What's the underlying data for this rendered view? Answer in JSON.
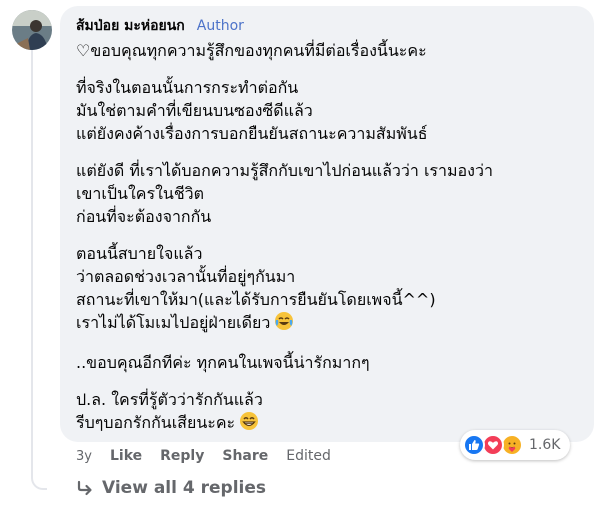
{
  "comment": {
    "author": "ส้มป่อย มะห่อยนก",
    "badge": "Author",
    "paragraphs": [
      [
        "♡ขอบคุณทุกความรู้สึกของทุกคนที่มีต่อเรื่องนี้นะคะ"
      ],
      [
        "ที่จริงในตอนนั้นการกระทำต่อกัน",
        "มันใช่ตามคำที่เขียนบนซองซีดีแล้ว",
        "แต่ยังคงค้างเรื่องการบอกยืนยันสถานะความสัมพันธ์"
      ],
      [
        "แต่ยังดี ที่เราได้บอกความรู้สึกกับเขาไปก่อนแล้วว่า เรามองว่า",
        "เขาเป็นใครในชีวิต",
        "ก่อนที่จะต้องจากกัน"
      ],
      [
        "ตอนนี้สบายใจแล้ว",
        "ว่าตลอดช่วงเวลานั้นที่อยู่ๆกันมา",
        "สถานะที่เขาให้มา(และได้รับการยืนยันโดยเพจนี้^^)",
        "เราไม่ได้โมเมไปอยู่ฝ่ายเดียว"
      ],
      [
        "..ขอบคุณอีกทีค่ะ ทุกคนในเพจนี้น่ารักมากๆ"
      ],
      [
        "ป.ล. ใครที่รู้ตัวว่ารักกันแล้ว",
        "รีบๆบอกรักกันเสียนะคะ"
      ]
    ],
    "emoji_laugh_cry": "laugh-cry-emoji",
    "emoji_grin": "grin-emoji"
  },
  "reactions": {
    "icons": [
      "like-icon",
      "love-icon",
      "care-icon"
    ],
    "count": "1.6K",
    "colors": {
      "like": "#1877f2",
      "love": "#f33e58",
      "care": "#f7b125"
    }
  },
  "actions": {
    "time": "3y",
    "like": "Like",
    "reply": "Reply",
    "share": "Share",
    "edited": "Edited"
  },
  "replies": {
    "label": "View all 4 replies"
  },
  "colors": {
    "bubble": "#f0f2f5",
    "author_badge": "#4d73c9",
    "secondary_text": "#65676b"
  }
}
